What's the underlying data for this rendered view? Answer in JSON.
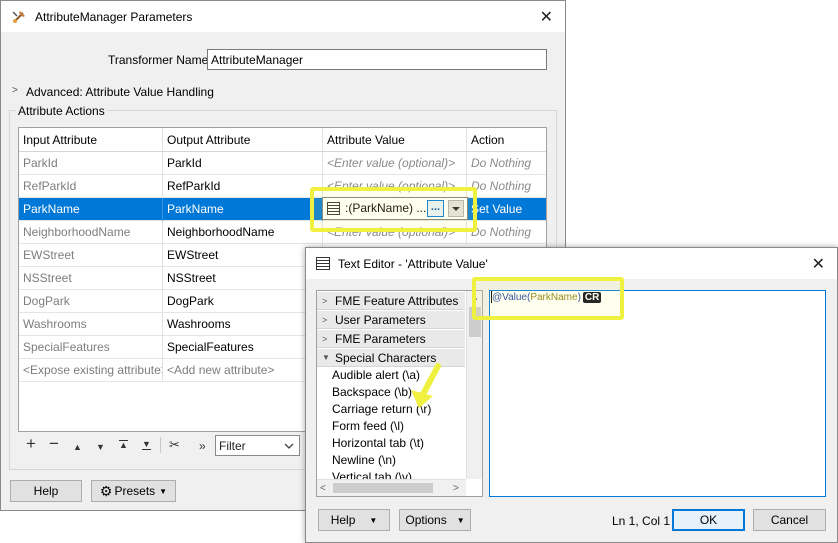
{
  "main_window": {
    "title": "AttributeManager Parameters",
    "close_glyph": "✕",
    "transformer_name_label": "Transformer Name:",
    "transformer_name_value": "AttributeManager",
    "advanced_label": "Advanced: Attribute Value Handling",
    "attribute_actions_label": "Attribute Actions",
    "columns": [
      "Input Attribute",
      "Output Attribute",
      "Attribute Value",
      "Action"
    ],
    "rows": [
      {
        "input": "ParkId",
        "output": "ParkId",
        "value": "<Enter value (optional)>",
        "action": "Do Nothing"
      },
      {
        "input": "RefParkId",
        "output": "RefParkId",
        "value": "<Enter value (optional)>",
        "action": "Do Nothing"
      },
      {
        "input": "ParkName",
        "output": "ParkName",
        "value": ":(ParkName) ...",
        "action": "Set Value",
        "selected": true
      },
      {
        "input": "NeighborhoodName",
        "output": "NeighborhoodName",
        "value": "<Enter value (optional)>",
        "action": "Do Nothing"
      },
      {
        "input": "EWStreet",
        "output": "EWStreet",
        "value": "",
        "action": ""
      },
      {
        "input": "NSStreet",
        "output": "NSStreet",
        "value": "",
        "action": ""
      },
      {
        "input": "DogPark",
        "output": "DogPark",
        "value": "",
        "action": ""
      },
      {
        "input": "Washrooms",
        "output": "Washrooms",
        "value": "",
        "action": ""
      },
      {
        "input": "SpecialFeatures",
        "output": "SpecialFeatures",
        "value": "",
        "action": ""
      },
      {
        "input": "<Expose existing attribute>",
        "output": "<Add new attribute>",
        "value": "",
        "action": ""
      }
    ],
    "value_button_label": "...",
    "filter_placeholder": "Filter",
    "help_label": "Help",
    "presets_label": "Presets"
  },
  "text_editor": {
    "title": "Text Editor - 'Attribute Value'",
    "close_glyph": "✕",
    "categories": [
      {
        "label": "FME Feature Attributes",
        "expanded": false
      },
      {
        "label": "User Parameters",
        "expanded": false
      },
      {
        "label": "FME Parameters",
        "expanded": false
      },
      {
        "label": "Special Characters",
        "expanded": true
      }
    ],
    "special_characters": [
      "Audible alert (\\a)",
      "Backspace (\\b)",
      "Carriage return (\\r)",
      "Form feed (\\l)",
      "Horizontal tab (\\t)",
      "Newline (\\n)",
      "Vertical tab (\\v)"
    ],
    "expression_function": "@Value(",
    "expression_attr": "ParkName",
    "expression_close": ")",
    "expression_token": "CR",
    "status": "Ln 1, Col 1",
    "help_label": "Help",
    "options_label": "Options",
    "ok_label": "OK",
    "cancel_label": "Cancel"
  },
  "colors": {
    "selection_blue": "#0078d7",
    "highlight_yellow": "#f0f040",
    "function_blue": "#1b3fa0",
    "attribute_olive": "#8a7a10"
  }
}
